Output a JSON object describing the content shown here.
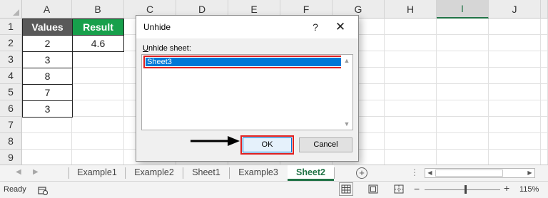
{
  "grid": {
    "columns": [
      "A",
      "B",
      "C",
      "D",
      "E",
      "F",
      "G",
      "H",
      "I",
      "J"
    ],
    "rows": [
      "1",
      "2",
      "3",
      "4",
      "5",
      "6",
      "7",
      "8",
      "9"
    ],
    "selected_column": "I",
    "cells": {
      "A1": "Values",
      "B1": "Result",
      "A2": "2",
      "B2": "4.6",
      "A3": "3",
      "A4": "8",
      "A5": "7",
      "A6": "3"
    }
  },
  "dialog": {
    "title": "Unhide",
    "help_label": "?",
    "close_label": "✕",
    "list_label_accel": "U",
    "list_label_rest": "nhide sheet:",
    "items": [
      "Sheet3"
    ],
    "selected_item": "Sheet3",
    "ok_label": "OK",
    "cancel_label": "Cancel"
  },
  "tabs": {
    "sheets": [
      "Example1",
      "Example2",
      "Sheet1",
      "Example3",
      "Sheet2"
    ],
    "active": "Sheet2",
    "add_label": "+",
    "more_label": "⋮"
  },
  "status": {
    "ready": "Ready",
    "zoom_level": "115%",
    "zoom_minus": "−",
    "zoom_plus": "+"
  },
  "colors": {
    "excel_green": "#217346",
    "header_dark": "#595959",
    "header_green": "#17a04b",
    "highlight_red": "#e02020",
    "selection_blue": "#0078d7"
  }
}
